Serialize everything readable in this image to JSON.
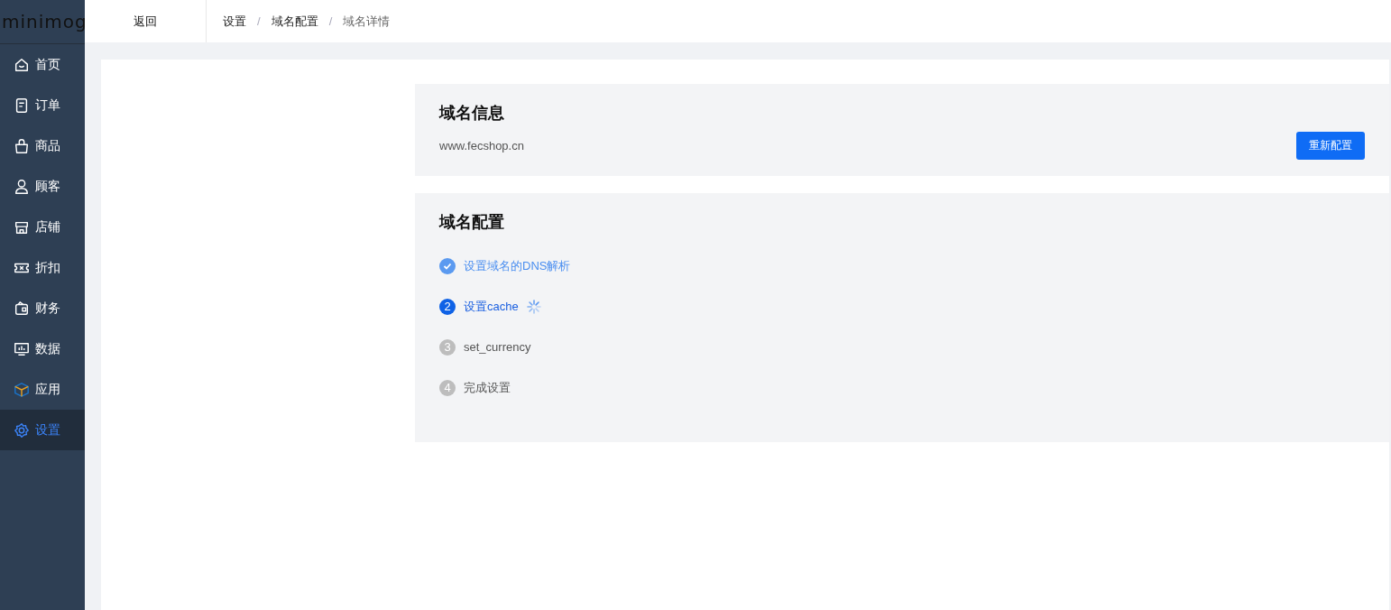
{
  "logo": "minimog",
  "sidebar": {
    "items": [
      {
        "label": "首页",
        "selected": false
      },
      {
        "label": "订单",
        "selected": false
      },
      {
        "label": "商品",
        "selected": false
      },
      {
        "label": "顾客",
        "selected": false
      },
      {
        "label": "店铺",
        "selected": false
      },
      {
        "label": "折扣",
        "selected": false
      },
      {
        "label": "财务",
        "selected": false
      },
      {
        "label": "数据",
        "selected": false
      },
      {
        "label": "应用",
        "selected": false
      },
      {
        "label": "设置",
        "selected": true
      }
    ]
  },
  "topbar": {
    "back": "返回",
    "breadcrumb": [
      "设置",
      "域名配置",
      "域名详情"
    ],
    "separator": "/"
  },
  "domain_info": {
    "title": "域名信息",
    "domain": "www.fecshop.cn",
    "button": "重新配置"
  },
  "domain_config": {
    "title": "域名配置",
    "steps": [
      {
        "kind": "done",
        "label": "设置域名的DNS解析"
      },
      {
        "kind": "active",
        "number": "2",
        "label": "设置cache"
      },
      {
        "kind": "waiting",
        "number": "3",
        "label": "set_currency"
      },
      {
        "kind": "waiting",
        "number": "4",
        "label": "完成设置"
      }
    ]
  }
}
